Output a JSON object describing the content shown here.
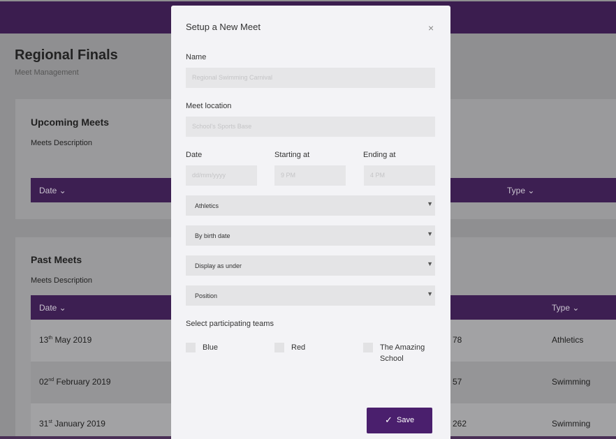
{
  "page": {
    "title": "Regional Finals",
    "subtitle": "Meet Management"
  },
  "upcoming": {
    "title": "Upcoming Meets",
    "description": "Meets Description",
    "columns": {
      "date": "Date ⌄",
      "type": "Type ⌄"
    }
  },
  "past": {
    "title": "Past Meets",
    "description": "Meets Description",
    "columns": {
      "date": "Date ⌄",
      "type": "Type ⌄"
    },
    "rows": [
      {
        "day": "13",
        "suffix": "th",
        "rest": " May 2019",
        "mid": "78",
        "type": "Athletics"
      },
      {
        "day": "02",
        "suffix": "nd",
        "rest": " February 2019",
        "mid": "57",
        "type": "Swimming"
      },
      {
        "day": "31",
        "suffix": "st",
        "rest": " January 2019",
        "mid": "262",
        "type": "Swimming"
      }
    ]
  },
  "modal": {
    "title": "Setup a New Meet",
    "close": "×",
    "name_label": "Name",
    "name_placeholder": "Regional Swimming Carnival",
    "location_label": "Meet location",
    "location_placeholder": "School's Sports Base",
    "date_label": "Date",
    "date_placeholder": "dd/mm/yyyy",
    "start_label": "Starting at",
    "start_placeholder": "9 PM",
    "end_label": "Ending at",
    "end_placeholder": "4 PM",
    "selects": [
      "Athletics",
      "By birth date",
      "Display as under",
      "Position"
    ],
    "caret": "▼",
    "teams_label": "Select participating teams",
    "teams": [
      "Blue",
      "Red",
      "The Amazing School"
    ],
    "save_icon": "✓",
    "save_label": "Save"
  }
}
